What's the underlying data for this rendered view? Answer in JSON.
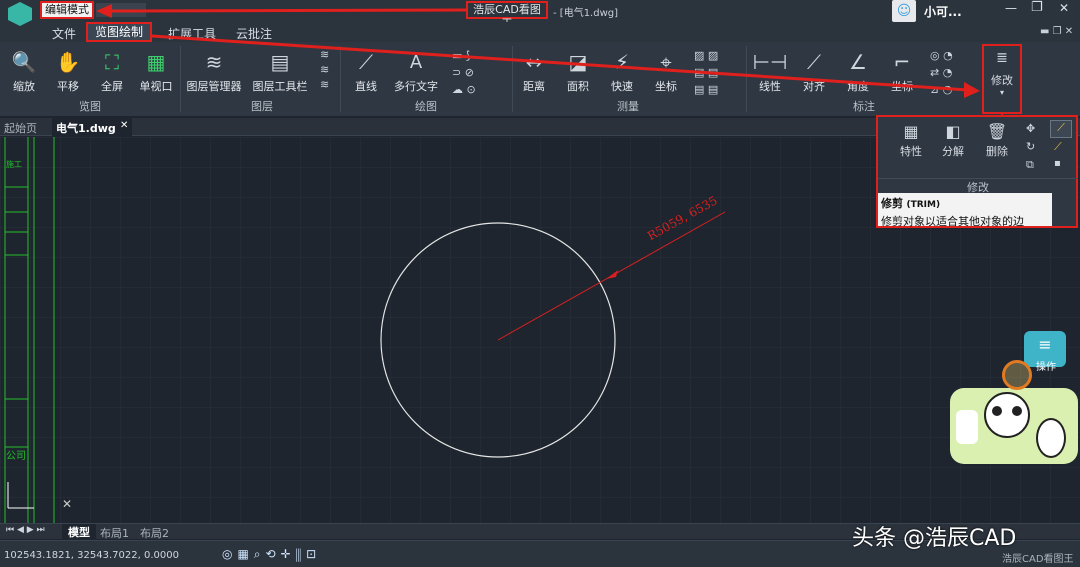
{
  "app": {
    "mode_button": "编辑模式",
    "title": "浩辰CAD看图王",
    "file": "- [电气1.dwg]",
    "user": "小可...",
    "min": "—",
    "restore": "❐",
    "close": "✕"
  },
  "menu": {
    "items": [
      "文件",
      "览图绘制",
      "扩展工具",
      "云批注"
    ],
    "active": 1
  },
  "ribbon": {
    "groups": [
      {
        "label": "览图"
      },
      {
        "label": "图层"
      },
      {
        "label": "绘图"
      },
      {
        "label": "测量"
      },
      {
        "label": "标注"
      }
    ],
    "buttons": {
      "zoom": "缩放",
      "pan": "平移",
      "fullscreen": "全屏",
      "single_view": "单视口",
      "layer_manager": "图层管理器",
      "layer_toolbar": "图层工具栏",
      "line": "直线",
      "mtext": "多行文字",
      "distance": "距离",
      "area": "面积",
      "quick": "快速",
      "coord": "坐标",
      "linear": "线性",
      "align": "对齐",
      "angle": "角度",
      "coordinate": "坐标",
      "modify": "修改"
    }
  },
  "modify_panel": {
    "title": "修改",
    "buttons": [
      "特性",
      "分解",
      "删除"
    ],
    "tooltip_title": "修剪",
    "tooltip_cmd": "(TRIM)",
    "tooltip_desc": "修剪对象以适合其他对象的边"
  },
  "tabs": {
    "start": "起始页",
    "file": "电气1.dwg",
    "close": "✕"
  },
  "drawing": {
    "radius_label": "R5059, 6535",
    "left_labels": [
      "施工",
      "公司"
    ]
  },
  "layouts": [
    "模型",
    "布局1",
    "布局2"
  ],
  "status": {
    "coords": "102543.1821, 32543.7022, 0.0000",
    "app_name": "浩辰CAD看图王"
  },
  "watermark": "头条 @浩辰CAD",
  "sticker": {
    "text": "操作"
  },
  "colors": {
    "accent_red": "#e0201c",
    "canvas": "#1e252e",
    "green": "#22c02a"
  }
}
